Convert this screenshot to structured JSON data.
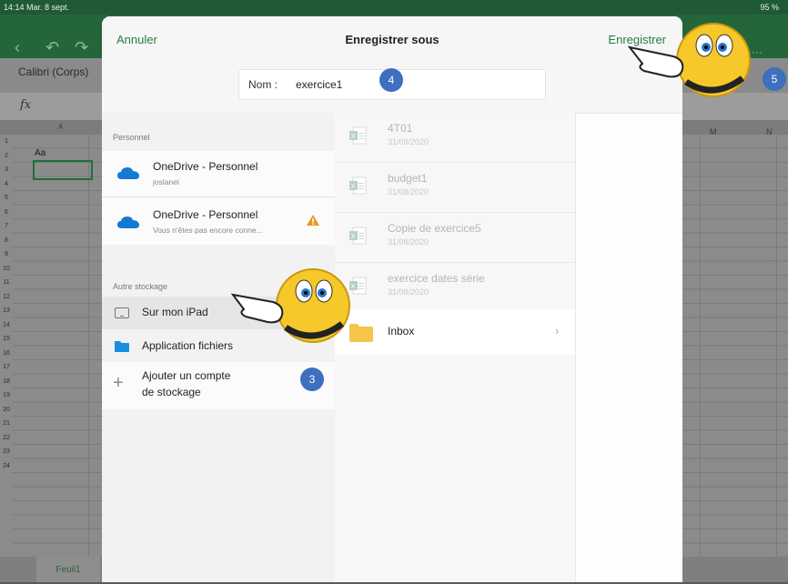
{
  "status_bar": {
    "left": "14:14  Mar. 8 sept.",
    "right": "95 %"
  },
  "excel": {
    "font": "Calibri (Corps)",
    "fx": "fx",
    "cell_a1": "Aa",
    "col_a": "A",
    "col_m": "M",
    "col_n": "N",
    "rows": [
      "1",
      "2",
      "3",
      "4",
      "5",
      "6",
      "7",
      "8",
      "9",
      "10",
      "11",
      "12",
      "13",
      "14",
      "15",
      "16",
      "17",
      "18",
      "19",
      "20",
      "21",
      "22",
      "23",
      "24"
    ],
    "sheet_tab": "Feuil1"
  },
  "dialog": {
    "cancel": "Annuler",
    "title": "Enregistrer sous",
    "save": "Enregistrer",
    "name_label": "Nom :",
    "name_value": "exercice1"
  },
  "locations": {
    "personal_header": "Personnel",
    "onedrive1_title": "OneDrive - Personnel",
    "onedrive1_sub": "joslanel",
    "onedrive2_title": "OneDrive - Personnel",
    "onedrive2_sub": "Vous n'êtes pas encore conne...",
    "other_header": "Autre stockage",
    "ipad": "Sur mon iPad",
    "files_app": "Application fichiers",
    "add_line1": "Ajouter un compte",
    "add_line2": "de stockage"
  },
  "files": [
    {
      "name": "4T01",
      "date": "31/08/2020"
    },
    {
      "name": "budget1",
      "date": "31/08/2020"
    },
    {
      "name": "Copie de exercice5",
      "date": "31/08/2020"
    },
    {
      "name": "exercice dates série",
      "date": "31/08/2020"
    }
  ],
  "inbox": "Inbox",
  "badges": {
    "b3": "3",
    "b4": "4",
    "b5": "5"
  },
  "colors": {
    "accent": "#2a7a46",
    "onedrive": "#1479d4",
    "badge": "#3f6fbf",
    "warning": "#e79a1a"
  }
}
